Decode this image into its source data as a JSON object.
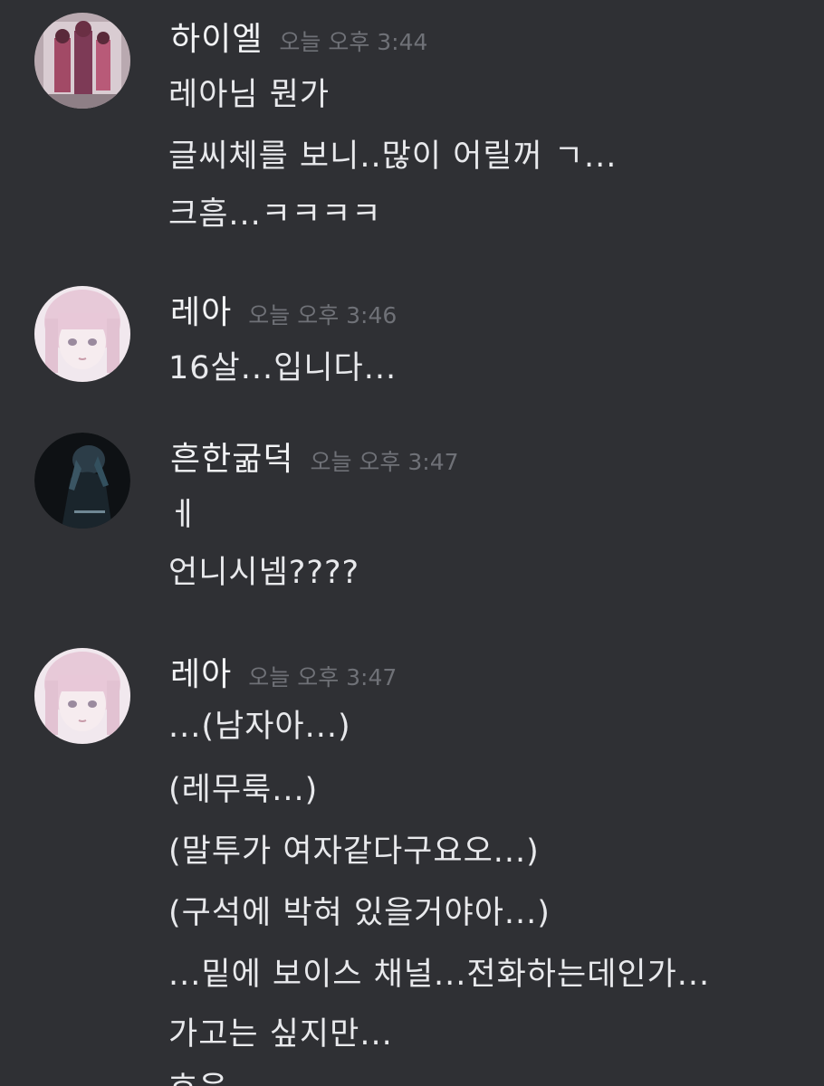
{
  "messages": [
    {
      "username": "하이엘",
      "timestamp": "오늘 오후 3:44",
      "lines": [
        "레아님 뭔가",
        "글씨체를 보니..많이 어릴꺼 ㄱ...",
        "크흠...ㅋㅋㅋㅋ"
      ]
    },
    {
      "username": "레아",
      "timestamp": "오늘 오후 3:46",
      "lines": [
        "16살...입니다..."
      ]
    },
    {
      "username": "흔한굶덕",
      "timestamp": "오늘 오후 3:47",
      "lines": [
        "ㅔ",
        "언니시넴????"
      ]
    },
    {
      "username": "레아",
      "timestamp": "오늘 오후 3:47",
      "lines": [
        "...(남자아...)",
        "(레무룩...)",
        "(말투가 여자같다구요오...)",
        "(구석에 박혀 있을거야아...)",
        "...밑에 보이스 채널...전화하는데인가...",
        "가고는 싶지만...",
        "흐음"
      ]
    }
  ],
  "colors": {
    "background": "#2f3034",
    "username": "#f2f3f5",
    "timestamp": "#6f7177",
    "text": "#e8e9ec"
  }
}
